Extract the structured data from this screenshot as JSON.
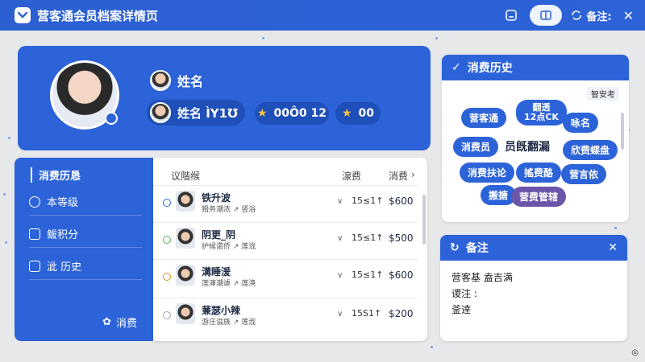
{
  "app": {
    "title": "营客通会员档案详情页",
    "note_label": "备注:"
  },
  "profile": {
    "name_label": "姓名",
    "name_value": "姓名 ÌY1℧",
    "stat1": "00Ô0 12",
    "stat2": "00"
  },
  "history_card": {
    "title": "消费历史",
    "link": "智安考",
    "tags": [
      "营客通",
      "翻透\n12点CK",
      "咏名",
      "消费员",
      "员旣翻漏",
      "欣费蝶盘",
      "消费扶论",
      "搖费酪",
      "营言依",
      "搬搪",
      "营费管辖"
    ]
  },
  "note_card": {
    "title": "备注",
    "lines": [
      "营客基 盍吉满",
      "谡注 :",
      "釜逹"
    ]
  },
  "left_panel": {
    "title": "消费历恳",
    "items": [
      "本等级",
      "鲅积分",
      "泚 历史"
    ],
    "footer": "消费"
  },
  "table": {
    "headers": [
      "议階缑",
      "湶费",
      "消费"
    ],
    "rows": [
      {
        "name": "铁升波",
        "sub": "猾务潮浓 ↗ 竖浴",
        "mid": "15≤1↑",
        "amount": "$600",
        "dot": "#2d63d8"
      },
      {
        "name": "阴更_阴",
        "sub": "护候诺侨 ↗ 莲浌",
        "mid": "15≤1↑",
        "amount": "$500",
        "dot": "#4caf50"
      },
      {
        "name": "溝睡湲",
        "sub": "莲渖潮谑 ↗ 莲涣",
        "mid": "15≤1↑",
        "amount": "$600",
        "dot": "#e08a1e"
      },
      {
        "name": "蒹瑟小辣",
        "sub": "游庄溢旐 ↗ 莲浌",
        "mid": "15S1↑",
        "amount": "$200",
        "dot": "#9aa3b2"
      }
    ]
  }
}
